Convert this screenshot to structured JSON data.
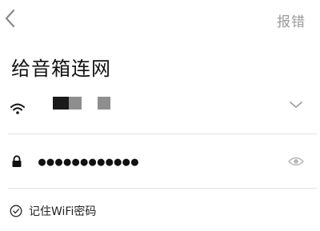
{
  "header": {
    "back_icon": "chevron-left-icon",
    "report_label": "报错"
  },
  "main": {
    "title": "给音箱连网",
    "wifi": {
      "icon": "wifi-icon",
      "dropdown_icon": "chevron-down-icon"
    },
    "password": {
      "icon": "lock-icon",
      "value": "●●●●●●●●●●●●",
      "visibility_icon": "eye-icon"
    },
    "remember": {
      "icon": "check-circle-icon",
      "label": "记住WiFi密码",
      "checked": true
    }
  },
  "colors": {
    "text": "#111111",
    "muted": "#9a9a9a",
    "divider": "#e3e3e3"
  }
}
